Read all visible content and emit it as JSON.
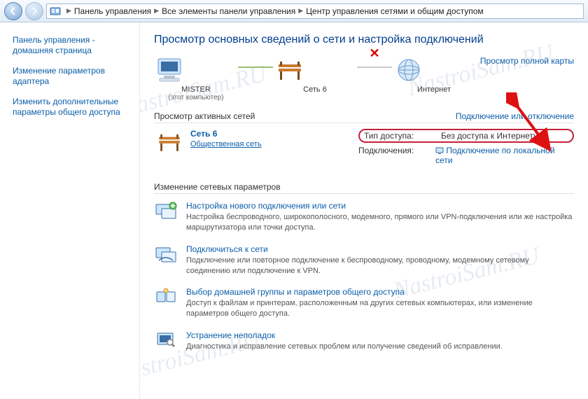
{
  "breadcrumb": {
    "seg1": "Панель управления",
    "seg2": "Все элементы панели управления",
    "seg3": "Центр управления сетями и общим доступом"
  },
  "sidebar": {
    "home": "Панель управления - домашняя страница",
    "adapter": "Изменение параметров адаптера",
    "sharing": "Изменить дополнительные параметры общего доступа"
  },
  "title": "Просмотр основных сведений о сети и настройка подключений",
  "map": {
    "full_map": "Просмотр полной карты",
    "node1": "MISTER",
    "node1_sub": "(этот компьютер)",
    "node2": "Сеть 6",
    "node3": "Интернет"
  },
  "active": {
    "head": "Просмотр активных сетей",
    "connect_link": "Подключение или отключение",
    "net_name": "Сеть 6",
    "net_type": "Общественная сеть",
    "k_access": "Тип доступа:",
    "v_access": "Без доступа к Интернету",
    "k_conn": "Подключения:",
    "v_conn": "Подключение по локальной сети"
  },
  "change_head": "Изменение сетевых параметров",
  "tasks": [
    {
      "link": "Настройка нового подключения или сети",
      "desc": "Настройка беспроводного, широкополосного, модемного, прямого или VPN-подключения или же настройка маршрутизатора или точки доступа."
    },
    {
      "link": "Подключиться к сети",
      "desc": "Подключение или повторное подключение к беспроводному, проводному, модемному сетевому соединению или подключение к VPN."
    },
    {
      "link": "Выбор домашней группы и параметров общего доступа",
      "desc": "Доступ к файлам и принтерам, расположенным на других сетевых компьютерах, или изменение параметров общего доступа."
    },
    {
      "link": "Устранение неполадок",
      "desc": "Диагностика и исправление сетевых проблем или получение сведений об исправлении."
    }
  ],
  "watermark": "NastroiSam.RU"
}
